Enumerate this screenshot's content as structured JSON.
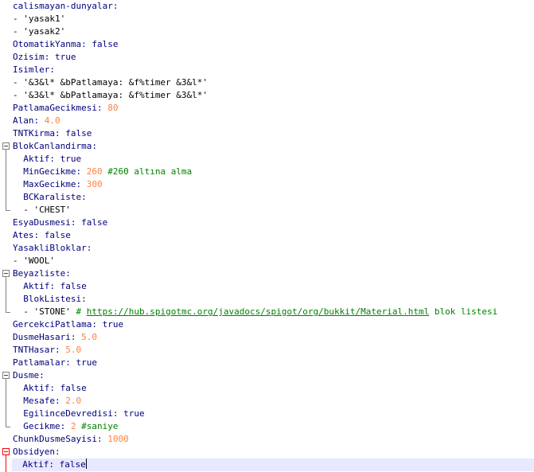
{
  "editor": {
    "lines": [
      [
        {
          "t": "calismayan-dunyalar:",
          "c": "k"
        }
      ],
      [
        {
          "t": "- ",
          "c": "d"
        },
        {
          "t": "'yasak1'",
          "c": "s"
        }
      ],
      [
        {
          "t": "- ",
          "c": "d"
        },
        {
          "t": "'yasak2'",
          "c": "s"
        }
      ],
      [
        {
          "t": "OtomatikYanma: ",
          "c": "k"
        },
        {
          "t": "false",
          "c": "b"
        }
      ],
      [
        {
          "t": "Ozisim: ",
          "c": "k"
        },
        {
          "t": "true",
          "c": "b"
        }
      ],
      [
        {
          "t": "Isimler:",
          "c": "k"
        }
      ],
      [
        {
          "t": "- ",
          "c": "d"
        },
        {
          "t": "'&3&l* &bPatlamaya: &f%timer &3&l*'",
          "c": "s"
        }
      ],
      [
        {
          "t": "- ",
          "c": "d"
        },
        {
          "t": "'&3&l* &bPatlamaya: &f%timer &3&l*'",
          "c": "s"
        }
      ],
      [
        {
          "t": "PatlamaGecikmesi: ",
          "c": "k"
        },
        {
          "t": "80",
          "c": "n"
        }
      ],
      [
        {
          "t": "Alan: ",
          "c": "k"
        },
        {
          "t": "4.0",
          "c": "n"
        }
      ],
      [
        {
          "t": "TNTKirma: ",
          "c": "k"
        },
        {
          "t": "false",
          "c": "b"
        }
      ],
      [
        {
          "t": "BlokCanlandirma:",
          "c": "k"
        }
      ],
      [
        {
          "t": "  Aktif: ",
          "c": "k"
        },
        {
          "t": "true",
          "c": "b"
        }
      ],
      [
        {
          "t": "  MinGecikme: ",
          "c": "k"
        },
        {
          "t": "260 ",
          "c": "n"
        },
        {
          "t": "#260 altına alma",
          "c": "c"
        }
      ],
      [
        {
          "t": "  MaxGecikme: ",
          "c": "k"
        },
        {
          "t": "300",
          "c": "n"
        }
      ],
      [
        {
          "t": "  BCKaraliste:",
          "c": "k"
        }
      ],
      [
        {
          "t": "  - ",
          "c": "d"
        },
        {
          "t": "'CHEST'",
          "c": "s"
        }
      ],
      [
        {
          "t": "EsyaDusmesi: ",
          "c": "k"
        },
        {
          "t": "false",
          "c": "b"
        }
      ],
      [
        {
          "t": "Ates: ",
          "c": "k"
        },
        {
          "t": "false",
          "c": "b"
        }
      ],
      [
        {
          "t": "YasakliBloklar:",
          "c": "k"
        }
      ],
      [
        {
          "t": "- ",
          "c": "d"
        },
        {
          "t": "'WOOL'",
          "c": "s"
        }
      ],
      [
        {
          "t": "Beyazliste:",
          "c": "k"
        }
      ],
      [
        {
          "t": "  Aktif: ",
          "c": "k"
        },
        {
          "t": "false",
          "c": "b"
        }
      ],
      [
        {
          "t": "  BlokListesi:",
          "c": "k"
        }
      ],
      [
        {
          "t": "  - ",
          "c": "d"
        },
        {
          "t": "'STONE' ",
          "c": "s"
        },
        {
          "t": "# ",
          "c": "c"
        },
        {
          "t": "https://hub.spigotmc.org/javadocs/spigot/org/bukkit/Material.html",
          "c": "u"
        },
        {
          "t": " blok listesi",
          "c": "c"
        }
      ],
      [
        {
          "t": "GercekciPatlama: ",
          "c": "k"
        },
        {
          "t": "true",
          "c": "b"
        }
      ],
      [
        {
          "t": "DusmeHasari: ",
          "c": "k"
        },
        {
          "t": "5.0",
          "c": "n"
        }
      ],
      [
        {
          "t": "TNTHasar: ",
          "c": "k"
        },
        {
          "t": "5.0",
          "c": "n"
        }
      ],
      [
        {
          "t": "Patlamalar: ",
          "c": "k"
        },
        {
          "t": "true",
          "c": "b"
        }
      ],
      [
        {
          "t": "Dusme:",
          "c": "k"
        }
      ],
      [
        {
          "t": "  Aktif: ",
          "c": "k"
        },
        {
          "t": "false",
          "c": "b"
        }
      ],
      [
        {
          "t": "  Mesafe: ",
          "c": "k"
        },
        {
          "t": "2.0",
          "c": "n"
        }
      ],
      [
        {
          "t": "  EgilinceDevredisi: ",
          "c": "k"
        },
        {
          "t": "true",
          "c": "b"
        }
      ],
      [
        {
          "t": "  Gecikme: ",
          "c": "k"
        },
        {
          "t": "2 ",
          "c": "n"
        },
        {
          "t": "#saniye",
          "c": "c"
        }
      ],
      [
        {
          "t": "ChunkDusmeSayisi: ",
          "c": "k"
        },
        {
          "t": "1000",
          "c": "n"
        }
      ],
      [
        {
          "t": "Obsidyen:",
          "c": "k"
        }
      ],
      [
        {
          "t": "  Aktif: ",
          "c": "k"
        },
        {
          "t": "false",
          "c": "b"
        }
      ]
    ],
    "current_line": 36,
    "folds": [
      {
        "start": 11,
        "end": 16,
        "red": false
      },
      {
        "start": 21,
        "end": 24,
        "red": false
      },
      {
        "start": 29,
        "end": 33,
        "red": false
      },
      {
        "start": 35,
        "end": 36,
        "red": true
      }
    ]
  },
  "colors": {
    "key": "#00007f",
    "boolean": "#000080",
    "number": "#ff7f3f",
    "comment": "#008000",
    "current_line_bg": "#e8e8ff",
    "fold_active": "#ff0000"
  }
}
